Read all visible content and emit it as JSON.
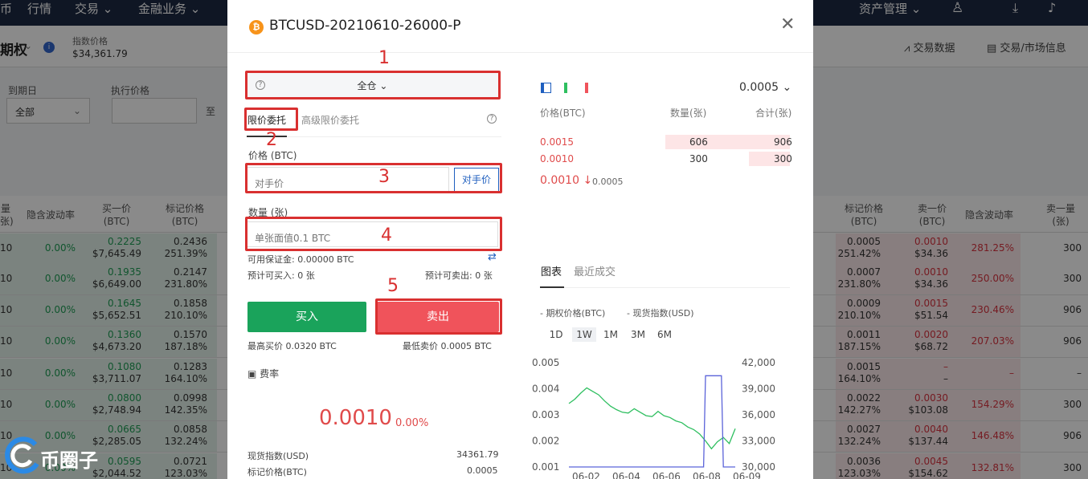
{
  "nav": {
    "items": [
      "币",
      "行情",
      "交易",
      "金融业务"
    ],
    "right_items": [
      "资产管理"
    ]
  },
  "subhead": {
    "title": "期权",
    "index_label": "指数价格",
    "index_value": "$34,361.79",
    "trade_data": "交易数据",
    "market_info": "交易/市场信息"
  },
  "filters": {
    "expiry_label": "到期日",
    "strike_label": "执行价格",
    "expiry_value": "全部",
    "to_label": "至"
  },
  "table": {
    "left_headers": [
      "量\n张)",
      "隐含波动率",
      "买一价\n(BTC)",
      "标记价格\n(BTC)"
    ],
    "right_headers": [
      "标记价格\n(BTC)",
      "卖一价\n(BTC)",
      "隐含波动率",
      "卖一量\n(张)"
    ],
    "rows": [
      {
        "lq": "10",
        "liv": "0.00%",
        "bid": "0.2225",
        "bid_usd": "$7,645.49",
        "mark": "0.2436",
        "mark_pct": "251.39%",
        "rmark": "0.0005",
        "rmark_pct": "251.42%",
        "ask": "0.0010",
        "ask_usd": "$34.36",
        "riv": "281.25%",
        "rq": "300"
      },
      {
        "lq": "10",
        "liv": "0.00%",
        "bid": "0.1935",
        "bid_usd": "$6,649.00",
        "mark": "0.2147",
        "mark_pct": "231.80%",
        "rmark": "0.0007",
        "rmark_pct": "231.80%",
        "ask": "0.0010",
        "ask_usd": "$34.36",
        "riv": "250.00%",
        "rq": "300"
      },
      {
        "lq": "10",
        "liv": "0.00%",
        "bid": "0.1645",
        "bid_usd": "$5,652.51",
        "mark": "0.1858",
        "mark_pct": "210.10%",
        "rmark": "0.0009",
        "rmark_pct": "210.10%",
        "ask": "0.0015",
        "ask_usd": "$51.54",
        "riv": "230.46%",
        "rq": "906"
      },
      {
        "lq": "10",
        "liv": "0.00%",
        "bid": "0.1360",
        "bid_usd": "$4,673.20",
        "mark": "0.1570",
        "mark_pct": "187.18%",
        "rmark": "0.0011",
        "rmark_pct": "187.15%",
        "ask": "0.0020",
        "ask_usd": "$68.72",
        "riv": "207.03%",
        "rq": "906"
      },
      {
        "lq": "10",
        "liv": "0.00%",
        "bid": "0.1080",
        "bid_usd": "$3,711.07",
        "mark": "0.1283",
        "mark_pct": "164.10%",
        "rmark": "0.0015",
        "rmark_pct": "164.10%",
        "ask": "–",
        "ask_usd": "–",
        "riv": "–",
        "rq": "–"
      },
      {
        "lq": "10",
        "liv": "0.00%",
        "bid": "0.0800",
        "bid_usd": "$2,748.94",
        "mark": "0.0998",
        "mark_pct": "142.35%",
        "rmark": "0.0022",
        "rmark_pct": "142.27%",
        "ask": "0.0030",
        "ask_usd": "$103.08",
        "riv": "154.29%",
        "rq": "300"
      },
      {
        "lq": "10",
        "liv": "0.00%",
        "bid": "0.0665",
        "bid_usd": "$2,285.05",
        "mark": "0.0858",
        "mark_pct": "132.24%",
        "rmark": "0.0027",
        "rmark_pct": "132.24%",
        "ask": "0.0040",
        "ask_usd": "$137.44",
        "riv": "146.48%",
        "rq": "906"
      },
      {
        "lq": "10",
        "liv": "0.00%",
        "bid": "0.0595",
        "bid_usd": "$2,044.52",
        "mark": "0.0721",
        "mark_pct": "123.03%",
        "rmark": "0.0036",
        "rmark_pct": "123.03%",
        "ask": "0.0045",
        "ask_usd": "$154.62",
        "riv": "132.81%",
        "rq": "300"
      }
    ]
  },
  "modal": {
    "title": "BTCUSD-20210610-26000-P",
    "close": "✕",
    "margin_mode": "全仓",
    "tab_limit": "限价委托",
    "tab_advanced": "高级限价委托",
    "price_label": "价格 (BTC)",
    "price_placeholder": "对手价",
    "opponent_button": "对手价",
    "qty_label": "数量 (张)",
    "qty_placeholder": "单张面值0.1 BTC",
    "avail_margin": "可用保证金: 0.00000 BTC",
    "est_buy": "预计可买入: 0 张",
    "est_sell": "预计可卖出: 0 张",
    "buy": "买入",
    "sell": "卖出",
    "max_buy": "最高买价 0.0320 BTC",
    "min_sell": "最低卖价 0.0005 BTC",
    "fee": "费率",
    "big_price": "0.0010",
    "big_pct": "0.00%",
    "spot_label": "现货指数(USD)",
    "spot_value": "34361.79",
    "mark_label": "标记价格(BTC)",
    "mark_value": "0.0005",
    "annotations": [
      "1",
      "2",
      "3",
      "4",
      "5"
    ]
  },
  "orderbook": {
    "precision": "0.0005",
    "headers": [
      "价格(BTC)",
      "数量(张)",
      "合计(张)"
    ],
    "asks": [
      {
        "price": "0.0015",
        "qty": "606",
        "total": "906",
        "depth": 1.0
      },
      {
        "price": "0.0010",
        "qty": "300",
        "total": "300",
        "depth": 0.33
      }
    ],
    "last_price": "0.0010",
    "last_arrow": "↓",
    "last_change": "0.0005"
  },
  "chart_panel": {
    "tab_chart": "图表",
    "tab_trades": "最近成交",
    "legend_option": "期权价格(BTC)",
    "legend_spot": "现货指数(USD)",
    "ranges": [
      "1D",
      "1W",
      "1M",
      "3M",
      "6M"
    ],
    "active_range": "1W"
  },
  "chart_data": {
    "type": "line",
    "x_ticks": [
      "06-02",
      "06-04",
      "06-06",
      "06-08",
      "06-09"
    ],
    "y_left_ticks": [
      "0.005",
      "0.004",
      "0.003",
      "0.002",
      "0.001"
    ],
    "y_left_lim": [
      0.001,
      0.005
    ],
    "y_right_ticks": [
      "42,000",
      "39,000",
      "36,000",
      "33,000",
      "30,000"
    ],
    "y_right_lim": [
      30000,
      42000
    ],
    "series": [
      {
        "name": "现货指数(USD)",
        "color": "#2fbf60",
        "axis": "right",
        "x": [
          0,
          0.3,
          0.6,
          0.9,
          1.2,
          1.5,
          1.8,
          2.1,
          2.4,
          2.7,
          3.0,
          3.3,
          3.6,
          3.9,
          4.2,
          4.5,
          4.8,
          5.1,
          5.4,
          5.7,
          6.0,
          6.3,
          6.6,
          6.9,
          7.2,
          7.5,
          7.8,
          8.1,
          8.4
        ],
        "y": [
          37300,
          37800,
          38500,
          39100,
          38700,
          38300,
          37600,
          37000,
          36600,
          36300,
          36200,
          36700,
          36300,
          35900,
          35800,
          36400,
          35900,
          35700,
          35300,
          35100,
          34600,
          34300,
          33800,
          33000,
          32100,
          32900,
          33400,
          32700,
          34400
        ]
      },
      {
        "name": "期权价格(BTC)",
        "color": "#5b63d9",
        "axis": "left",
        "x": [
          0,
          6.8,
          6.9,
          7.7,
          7.8,
          8.4
        ],
        "y": [
          0.001,
          0.001,
          0.0045,
          0.0045,
          0.001,
          0.001
        ]
      }
    ],
    "x_lim": [
      0,
      8.4
    ]
  },
  "watermark": {
    "text": "币圈子"
  }
}
